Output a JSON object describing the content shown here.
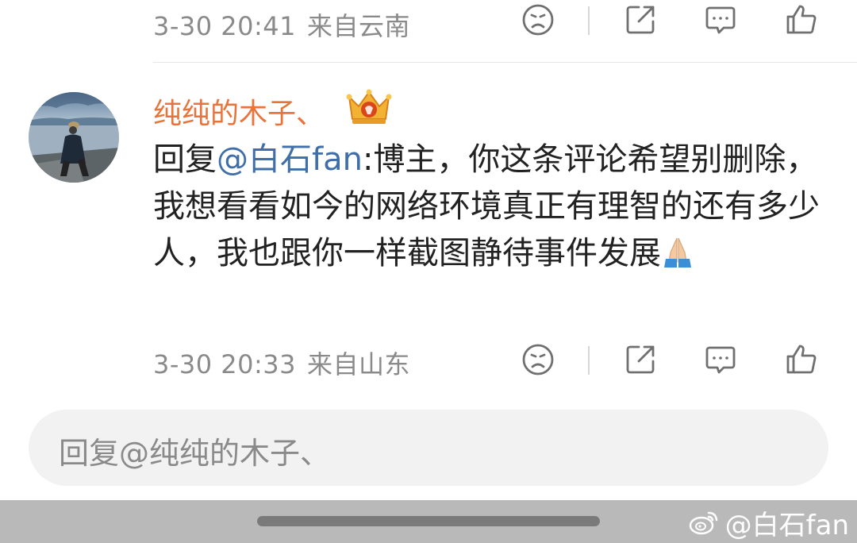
{
  "previous_comment": {
    "timestamp": "3-30 20:41",
    "location": "来自云南"
  },
  "comment": {
    "username": "纯纯的木子、",
    "badge_icon": "crown-icon",
    "reply_prefix": "回复",
    "mention": "@白石fan",
    "text": ":博主，你这条评论希望别删除，我想看看如今的网络环境真正有理智的还有多少人，我也跟你一样截图静待事件发展",
    "emoji": "folded-hands",
    "timestamp": "3-30 20:33",
    "location": "来自山东"
  },
  "actions": [
    "dislike-icon",
    "share-icon",
    "comment-icon",
    "like-icon"
  ],
  "reply_input": {
    "placeholder": "回复@纯纯的木子、"
  },
  "watermark": {
    "text": "@白石fan"
  },
  "colors": {
    "username": "#e8743b",
    "mention": "#3f6ea8",
    "meta": "#8a8a8a",
    "icon": "#707070"
  }
}
